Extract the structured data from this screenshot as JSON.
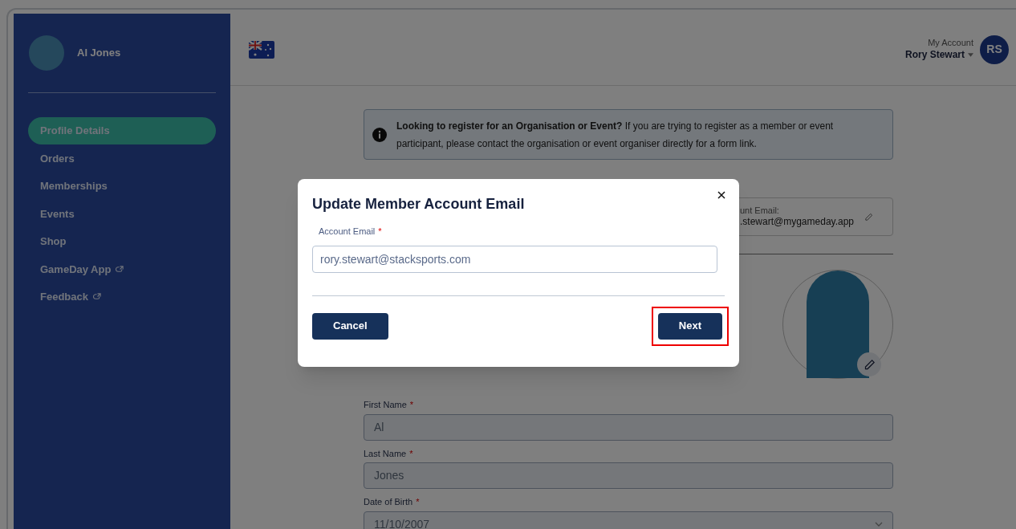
{
  "sidebar": {
    "user_name": "Al Jones",
    "items": [
      {
        "label": "Profile Details",
        "selected": true,
        "external": false
      },
      {
        "label": "Orders",
        "selected": false,
        "external": false
      },
      {
        "label": "Memberships",
        "selected": false,
        "external": false
      },
      {
        "label": "Events",
        "selected": false,
        "external": false
      },
      {
        "label": "Shop",
        "selected": false,
        "external": false
      },
      {
        "label": "GameDay App",
        "selected": false,
        "external": true
      },
      {
        "label": "Feedback",
        "selected": false,
        "external": true
      }
    ]
  },
  "header": {
    "account_label": "My Account",
    "account_name": "Rory Stewart",
    "initials": "RS"
  },
  "notice": {
    "text": "**Looking to register for an Organisation or Event?** If you are trying to register as a member or event participant, please contact the organisation or event organiser directly for a form link."
  },
  "account_email": {
    "label": "unt Email:",
    "value": ".stewart@mygameday.app"
  },
  "fields": [
    {
      "label": "First Name",
      "required_mark": "*",
      "value": "Al",
      "kind": "text"
    },
    {
      "label": "Last Name",
      "required_mark": "*",
      "value": "Jones",
      "kind": "text"
    },
    {
      "label": "Date of Birth",
      "required_mark": "*",
      "value": "11/10/2007",
      "kind": "select"
    }
  ],
  "modal": {
    "title": "Update Member Account Email",
    "field_label": "Account Email",
    "required_mark": "*",
    "value": "rory.stewart@stacksports.com",
    "buttons": [
      {
        "label": "Cancel",
        "highlighted": false
      },
      {
        "label": "Next",
        "highlighted": true
      }
    ]
  }
}
